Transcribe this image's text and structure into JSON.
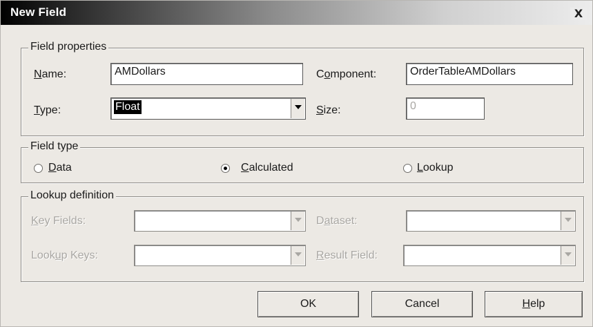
{
  "window": {
    "title": "New Field",
    "close_label": "X"
  },
  "field_properties": {
    "group_label": "Field properties",
    "name_label_u": "N",
    "name_label_rest": "ame:",
    "name_value": "AMDollars",
    "component_label_pre": "C",
    "component_label_u": "o",
    "component_label_rest": "mponent:",
    "component_value": "OrderTableAMDollars",
    "type_label_u": "T",
    "type_label_rest": "ype:",
    "type_value": "Float",
    "size_label_u": "S",
    "size_label_rest": "ize:",
    "size_value": "0"
  },
  "field_type": {
    "group_label": "Field type",
    "options": [
      {
        "u": "D",
        "rest": "ata",
        "selected": false
      },
      {
        "u": "C",
        "rest": "alculated",
        "selected": true
      },
      {
        "u": "L",
        "rest": "ookup",
        "selected": false
      }
    ]
  },
  "lookup_definition": {
    "group_label": "Lookup definition",
    "key_fields_u": "K",
    "key_fields_rest": "ey Fields:",
    "dataset_pre": "D",
    "dataset_u": "a",
    "dataset_rest": "taset:",
    "lookup_keys_pre": "Look",
    "lookup_keys_u": "u",
    "lookup_keys_rest": "p Keys:",
    "result_field_u": "R",
    "result_field_rest": "esult Field:"
  },
  "buttons": {
    "ok": "OK",
    "cancel": "Cancel",
    "help_u": "H",
    "help_rest": "elp"
  }
}
